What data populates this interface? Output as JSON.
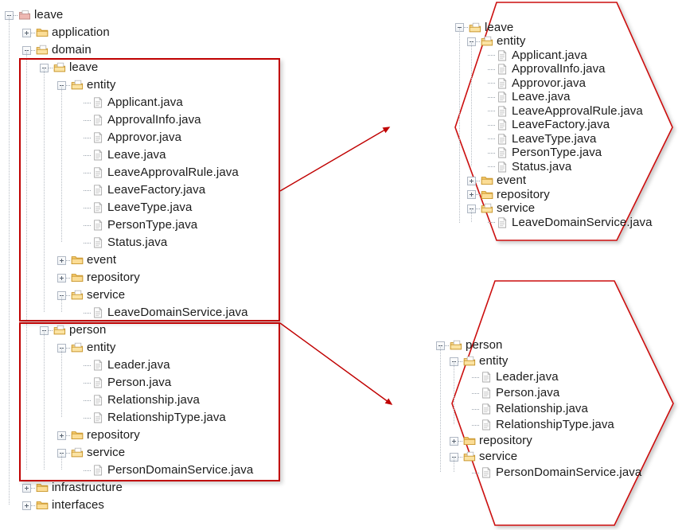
{
  "diagram": {
    "title": "Domain package structure with bounded-context callouts",
    "accent_color": "#c00000",
    "text_color": "#1b1b1b"
  },
  "main_tree": {
    "name": "package-explorer-tree",
    "nodes": [
      {
        "label": "leave",
        "icon": "package-root-icon",
        "state": "expanded-root",
        "depth": 0
      },
      {
        "label": "application",
        "icon": "folder-closed-icon",
        "state": "collapsed",
        "depth": 1
      },
      {
        "label": "domain",
        "icon": "package-open-icon",
        "state": "expanded",
        "depth": 1
      },
      {
        "label": "leave",
        "icon": "package-open-icon",
        "state": "expanded",
        "depth": 2
      },
      {
        "label": "entity",
        "icon": "package-open-icon",
        "state": "expanded",
        "depth": 3
      },
      {
        "label": "Applicant.java",
        "icon": "java-file-icon",
        "state": "leaf",
        "depth": 4
      },
      {
        "label": "ApprovalInfo.java",
        "icon": "java-file-icon",
        "state": "leaf",
        "depth": 4
      },
      {
        "label": "Approvor.java",
        "icon": "java-file-icon",
        "state": "leaf",
        "depth": 4
      },
      {
        "label": "Leave.java",
        "icon": "java-file-icon",
        "state": "leaf",
        "depth": 4
      },
      {
        "label": "LeaveApprovalRule.java",
        "icon": "java-file-icon",
        "state": "leaf",
        "depth": 4
      },
      {
        "label": "LeaveFactory.java",
        "icon": "java-file-icon",
        "state": "leaf",
        "depth": 4
      },
      {
        "label": "LeaveType.java",
        "icon": "java-file-icon",
        "state": "leaf",
        "depth": 4
      },
      {
        "label": "PersonType.java",
        "icon": "java-file-icon",
        "state": "leaf",
        "depth": 4
      },
      {
        "label": "Status.java",
        "icon": "java-file-icon",
        "state": "leaf-last",
        "depth": 4
      },
      {
        "label": "event",
        "icon": "folder-closed-icon",
        "state": "collapsed",
        "depth": 3
      },
      {
        "label": "repository",
        "icon": "folder-closed-icon",
        "state": "collapsed",
        "depth": 3
      },
      {
        "label": "service",
        "icon": "package-open-icon",
        "state": "expanded",
        "depth": 3
      },
      {
        "label": "LeaveDomainService.java",
        "icon": "java-file-icon",
        "state": "leaf-last",
        "depth": 4
      },
      {
        "label": "person",
        "icon": "package-open-icon",
        "state": "expanded",
        "depth": 2
      },
      {
        "label": "entity",
        "icon": "package-open-icon",
        "state": "expanded",
        "depth": 3
      },
      {
        "label": "Leader.java",
        "icon": "java-file-icon",
        "state": "leaf",
        "depth": 4
      },
      {
        "label": "Person.java",
        "icon": "java-file-icon",
        "state": "leaf",
        "depth": 4
      },
      {
        "label": "Relationship.java",
        "icon": "java-file-icon",
        "state": "leaf",
        "depth": 4
      },
      {
        "label": "RelationshipType.java",
        "icon": "java-file-icon",
        "state": "leaf-last",
        "depth": 4
      },
      {
        "label": "repository",
        "icon": "folder-closed-icon",
        "state": "collapsed",
        "depth": 3
      },
      {
        "label": "service",
        "icon": "package-open-icon",
        "state": "expanded",
        "depth": 3
      },
      {
        "label": "PersonDomainService.java",
        "icon": "java-file-icon",
        "state": "leaf-last",
        "depth": 4
      },
      {
        "label": "infrastructure",
        "icon": "folder-closed-icon",
        "state": "collapsed",
        "depth": 1
      },
      {
        "label": "interfaces",
        "icon": "folder-closed-icon",
        "state": "collapsed",
        "depth": 1
      }
    ]
  },
  "callout_leave": {
    "name": "leave-context-hexagon",
    "nodes": [
      {
        "label": "leave",
        "icon": "package-open-icon",
        "state": "expanded",
        "depth": 0
      },
      {
        "label": "entity",
        "icon": "package-open-icon",
        "state": "expanded",
        "depth": 1
      },
      {
        "label": "Applicant.java",
        "icon": "java-file-icon",
        "state": "leaf",
        "depth": 2
      },
      {
        "label": "ApprovalInfo.java",
        "icon": "java-file-icon",
        "state": "leaf",
        "depth": 2
      },
      {
        "label": "Approvor.java",
        "icon": "java-file-icon",
        "state": "leaf",
        "depth": 2
      },
      {
        "label": "Leave.java",
        "icon": "java-file-icon",
        "state": "leaf",
        "depth": 2
      },
      {
        "label": "LeaveApprovalRule.java",
        "icon": "java-file-icon",
        "state": "leaf",
        "depth": 2
      },
      {
        "label": "LeaveFactory.java",
        "icon": "java-file-icon",
        "state": "leaf",
        "depth": 2
      },
      {
        "label": "LeaveType.java",
        "icon": "java-file-icon",
        "state": "leaf",
        "depth": 2
      },
      {
        "label": "PersonType.java",
        "icon": "java-file-icon",
        "state": "leaf",
        "depth": 2
      },
      {
        "label": "Status.java",
        "icon": "java-file-icon",
        "state": "leaf-last",
        "depth": 2
      },
      {
        "label": "event",
        "icon": "folder-closed-icon",
        "state": "collapsed",
        "depth": 1
      },
      {
        "label": "repository",
        "icon": "folder-closed-icon",
        "state": "collapsed",
        "depth": 1
      },
      {
        "label": "service",
        "icon": "package-open-icon",
        "state": "expanded",
        "depth": 1
      },
      {
        "label": "LeaveDomainService.java",
        "icon": "java-file-icon",
        "state": "leaf-last",
        "depth": 2
      }
    ]
  },
  "callout_person": {
    "name": "person-context-hexagon",
    "nodes": [
      {
        "label": "person",
        "icon": "package-open-icon",
        "state": "expanded",
        "depth": 0
      },
      {
        "label": "entity",
        "icon": "package-open-icon",
        "state": "expanded",
        "depth": 1
      },
      {
        "label": "Leader.java",
        "icon": "java-file-icon",
        "state": "leaf",
        "depth": 2
      },
      {
        "label": "Person.java",
        "icon": "java-file-icon",
        "state": "leaf",
        "depth": 2
      },
      {
        "label": "Relationship.java",
        "icon": "java-file-icon",
        "state": "leaf",
        "depth": 2
      },
      {
        "label": "RelationshipType.java",
        "icon": "java-file-icon",
        "state": "leaf-last",
        "depth": 2
      },
      {
        "label": "repository",
        "icon": "folder-closed-icon",
        "state": "collapsed",
        "depth": 1
      },
      {
        "label": "service",
        "icon": "package-open-icon",
        "state": "expanded",
        "depth": 1
      },
      {
        "label": "PersonDomainService.java",
        "icon": "java-file-icon",
        "state": "leaf-last",
        "depth": 2
      }
    ]
  }
}
